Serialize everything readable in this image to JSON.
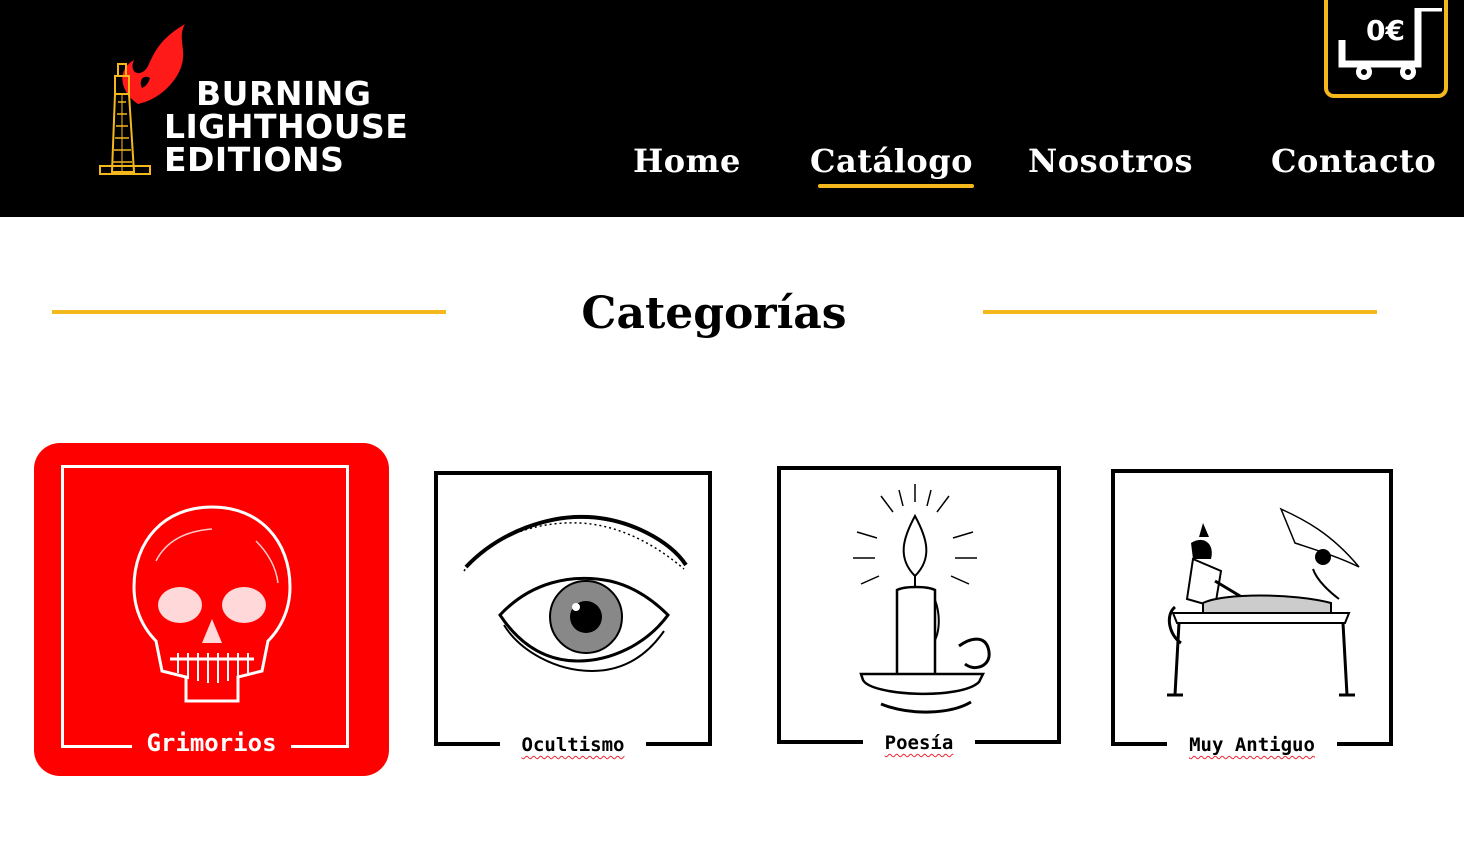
{
  "brand": {
    "line1": "BURNING",
    "line2": "LIGHTHOUSE",
    "line3": "EDITIONS"
  },
  "cart": {
    "total": "0€",
    "icon": "cart-icon"
  },
  "nav": {
    "items": [
      {
        "label": "Home"
      },
      {
        "label": "Catálogo"
      },
      {
        "label": "Nosotros"
      },
      {
        "label": "Contacto"
      }
    ],
    "active": "Catálogo"
  },
  "section": {
    "title": "Categorías"
  },
  "categories": [
    {
      "label": "Grimorios",
      "icon": "skull-icon"
    },
    {
      "label": "Ocultismo",
      "icon": "eye-icon"
    },
    {
      "label": "Poesía",
      "icon": "candle-icon"
    },
    {
      "label": "Muy Antiguo",
      "icon": "egyptian-mummy-icon"
    }
  ],
  "colors": {
    "header_bg": "#000000",
    "accent": "#f5b81c",
    "featured": "#ff0000",
    "flame": "#ff1a1a"
  }
}
